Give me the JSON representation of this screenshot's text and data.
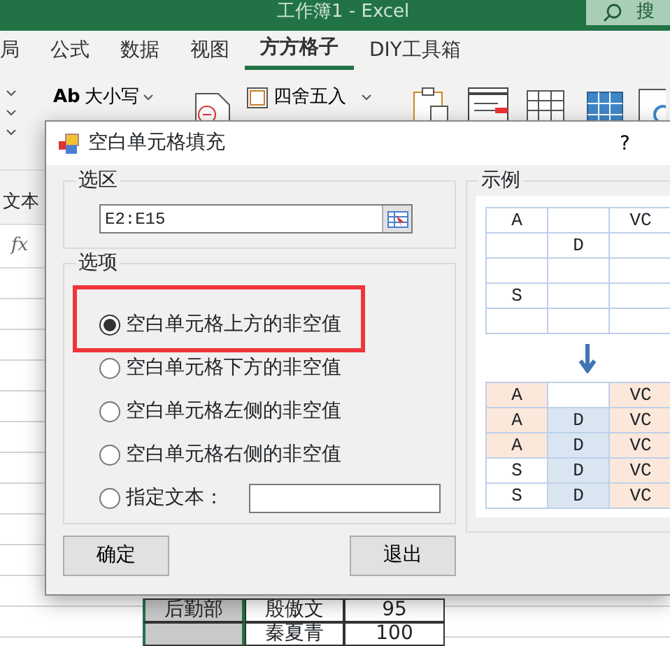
{
  "window": {
    "title": "工作簿1  -  Excel",
    "search_text": "搜"
  },
  "ribbon_tabs": [
    {
      "label": "局",
      "selected": false
    },
    {
      "label": "公式",
      "selected": false
    },
    {
      "label": "数据",
      "selected": false
    },
    {
      "label": "视图",
      "selected": false
    },
    {
      "label": "方方格子",
      "selected": true
    },
    {
      "label": "DIY工具箱",
      "selected": false
    }
  ],
  "ribbon": {
    "case_button": {
      "prefix": "Ab",
      "label": "大小写"
    },
    "round_button": {
      "label": "四舍五入"
    }
  },
  "name_box": "文本",
  "formula_label": "fx",
  "sheet_rows": [
    {
      "dept": "后勤部",
      "name": "殷傲文",
      "score": "95"
    },
    {
      "name": "秦夏青",
      "score": "100"
    }
  ],
  "dialog": {
    "title": "空白单元格填充",
    "help": "?",
    "range_group": {
      "label": "选区",
      "value": "E2:E15"
    },
    "options_group": {
      "label": "选项",
      "options": [
        {
          "kind": "radio",
          "label": "空白单元格上方的非空值",
          "selected": true,
          "highlighted": true
        },
        {
          "kind": "radio",
          "label": "空白单元格下方的非空值",
          "selected": false,
          "highlighted": false
        },
        {
          "kind": "radio",
          "label": "空白单元格左侧的非空值",
          "selected": false,
          "highlighted": false
        },
        {
          "kind": "radio",
          "label": "空白单元格右侧的非空值",
          "selected": false,
          "highlighted": false
        },
        {
          "kind": "radio_text",
          "label": "指定文本：",
          "selected": false,
          "highlighted": false
        }
      ]
    },
    "buttons": [
      "确定",
      "退出"
    ],
    "example": {
      "label": "示例",
      "before": [
        [
          {
            "kind": "text",
            "text": "A"
          },
          {
            "kind": "blank"
          },
          {
            "kind": "text",
            "text": "VC"
          }
        ],
        [
          {
            "kind": "blank"
          },
          {
            "kind": "text",
            "text": "D"
          },
          {
            "kind": "blank"
          }
        ],
        [
          {
            "kind": "blank"
          },
          {
            "kind": "blank"
          },
          {
            "kind": "blank"
          }
        ],
        [
          {
            "kind": "text",
            "text": "S"
          },
          {
            "kind": "blank"
          },
          {
            "kind": "blank"
          }
        ],
        [
          {
            "kind": "blank"
          },
          {
            "kind": "blank"
          },
          {
            "kind": "blank"
          }
        ]
      ],
      "after": [
        [
          {
            "kind": "text",
            "text": "A",
            "color": "#fce8db"
          },
          {
            "kind": "blank"
          },
          {
            "kind": "text",
            "text": "VC",
            "color": "#fce8db"
          }
        ],
        [
          {
            "kind": "text",
            "text": "A",
            "color": "#fce8db"
          },
          {
            "kind": "text",
            "text": "D",
            "color": "#dae5f2"
          },
          {
            "kind": "text",
            "text": "VC",
            "color": "#fce8db"
          }
        ],
        [
          {
            "kind": "text",
            "text": "A",
            "color": "#fce8db"
          },
          {
            "kind": "text",
            "text": "D",
            "color": "#dae5f2"
          },
          {
            "kind": "text",
            "text": "VC",
            "color": "#fce8db"
          }
        ],
        [
          {
            "kind": "text",
            "text": "S"
          },
          {
            "kind": "text",
            "text": "D",
            "color": "#dae5f2"
          },
          {
            "kind": "text",
            "text": "VC",
            "color": "#fce8db"
          }
        ],
        [
          {
            "kind": "text",
            "text": "S"
          },
          {
            "kind": "text",
            "text": "D",
            "color": "#dae5f2"
          },
          {
            "kind": "text",
            "text": "VC",
            "color": "#fce8db"
          }
        ]
      ]
    }
  }
}
